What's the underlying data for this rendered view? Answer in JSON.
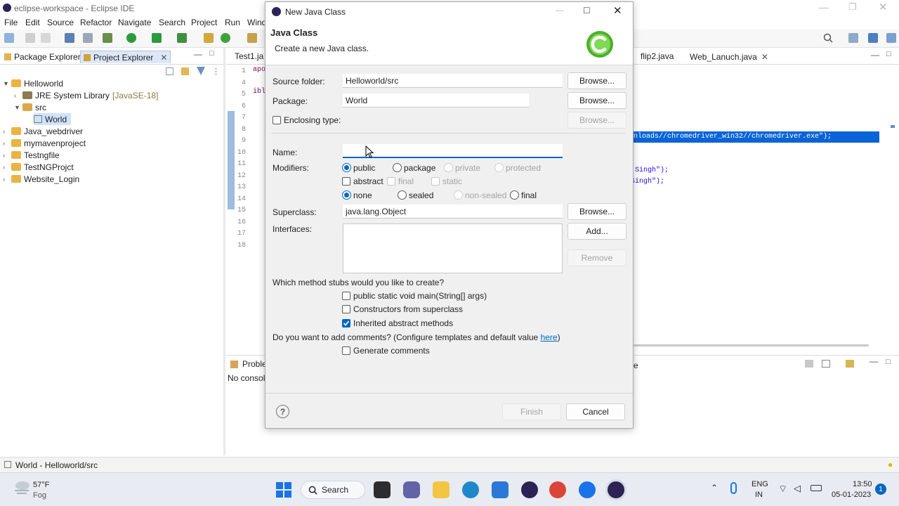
{
  "window": {
    "title": "eclipse-workspace - Eclipse IDE"
  },
  "menu": [
    "File",
    "Edit",
    "Source",
    "Refactor",
    "Navigate",
    "Search",
    "Project",
    "Run",
    "Wind"
  ],
  "left_panel": {
    "tabs": [
      "Package Explorer",
      "Project Explorer"
    ],
    "tree": [
      {
        "label": "Helloworld"
      },
      {
        "label": "JRE System Library",
        "suffix": "[JavaSE-18]"
      },
      {
        "label": "src"
      },
      {
        "label": "World"
      },
      {
        "label": "Java_webdriver"
      },
      {
        "label": "mymavenproject"
      },
      {
        "label": "Testngfile"
      },
      {
        "label": "TestNGProjct"
      },
      {
        "label": "Website_Login"
      }
    ]
  },
  "editor": {
    "tabs": [
      "Test1.ja",
      "flip2.java",
      "Web_Lanuch.java"
    ],
    "line_numbers": [
      "1",
      "4",
      "5",
      "6",
      "7",
      "8",
      "9",
      "10",
      "11",
      "12",
      "13",
      "14",
      "15",
      "16",
      "17",
      "18"
    ],
    "code_fragments": {
      "l1": "apo",
      "l5": "ibl",
      "selected": "nloads//chromedriver_win32//chromedriver.exe\");",
      "l12": "Singh\");",
      "l13": "Singh\");"
    }
  },
  "console": {
    "tab": "Proble",
    "text": "No console",
    "right_tab": "e"
  },
  "statusbar": {
    "text": "World - Helloworld/src"
  },
  "dialog": {
    "title": "New Java Class",
    "heading": "Java Class",
    "description": "Create a new Java class.",
    "source_folder": {
      "label": "Source folder:",
      "value": "Helloworld/src",
      "button": "Browse..."
    },
    "package": {
      "label": "Package:",
      "value": "World",
      "button": "Browse..."
    },
    "enclosing": {
      "label": "Enclosing type:",
      "button": "Browse..."
    },
    "name": {
      "label": "Name:",
      "value": ""
    },
    "modifiers": {
      "label": "Modifiers:",
      "access": [
        "public",
        "package",
        "private",
        "protected"
      ],
      "flags": [
        "abstract",
        "final",
        "static"
      ],
      "sealing": [
        "none",
        "sealed",
        "non-sealed",
        "final"
      ]
    },
    "superclass": {
      "label": "Superclass:",
      "value": "java.lang.Object",
      "button": "Browse..."
    },
    "interfaces": {
      "label": "Interfaces:",
      "add": "Add...",
      "remove": "Remove"
    },
    "stubs": {
      "question": "Which method stubs would you like to create?",
      "options": [
        "public static void main(String[] args)",
        "Constructors from superclass",
        "Inherited abstract methods"
      ]
    },
    "comments": {
      "question": "Do you want to add comments? (Configure templates and default value ",
      "link": "here",
      "close": ")",
      "option": "Generate comments"
    },
    "finish": "Finish",
    "cancel": "Cancel"
  },
  "taskbar": {
    "weather_temp": "57°F",
    "weather_desc": "Fog",
    "search": "Search",
    "lang1": "ENG",
    "lang2": "IN",
    "time": "13:50",
    "date": "05-01-2023",
    "notifications": "1"
  },
  "colors": {
    "accent": "#0067c0",
    "selection": "#0a64d8",
    "folder": "#e9b443"
  }
}
